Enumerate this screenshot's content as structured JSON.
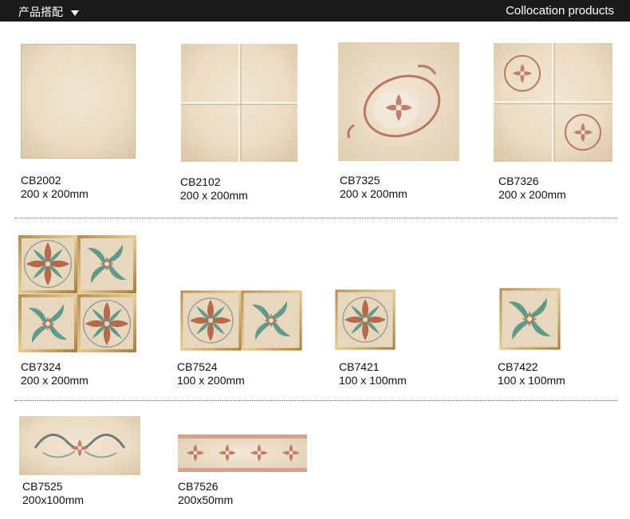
{
  "header": {
    "left_title": "产品搭配",
    "right_title": "Collocation products"
  },
  "products": [
    {
      "code": "CB2002",
      "size": "200 x 200mm"
    },
    {
      "code": "CB2102",
      "size": "200 x 200mm"
    },
    {
      "code": "CB7325",
      "size": "200 x 200mm"
    },
    {
      "code": "CB7326",
      "size": "200 x 200mm"
    },
    {
      "code": "CB7324",
      "size": "200 x 200mm"
    },
    {
      "code": "CB7524",
      "size": "100 x 200mm"
    },
    {
      "code": "CB7421",
      "size": "100 x 100mm"
    },
    {
      "code": "CB7422",
      "size": "100 x 100mm"
    },
    {
      "code": "CB7525",
      "size": "200x100mm"
    },
    {
      "code": "CB7526",
      "size": "200x50mm"
    }
  ]
}
